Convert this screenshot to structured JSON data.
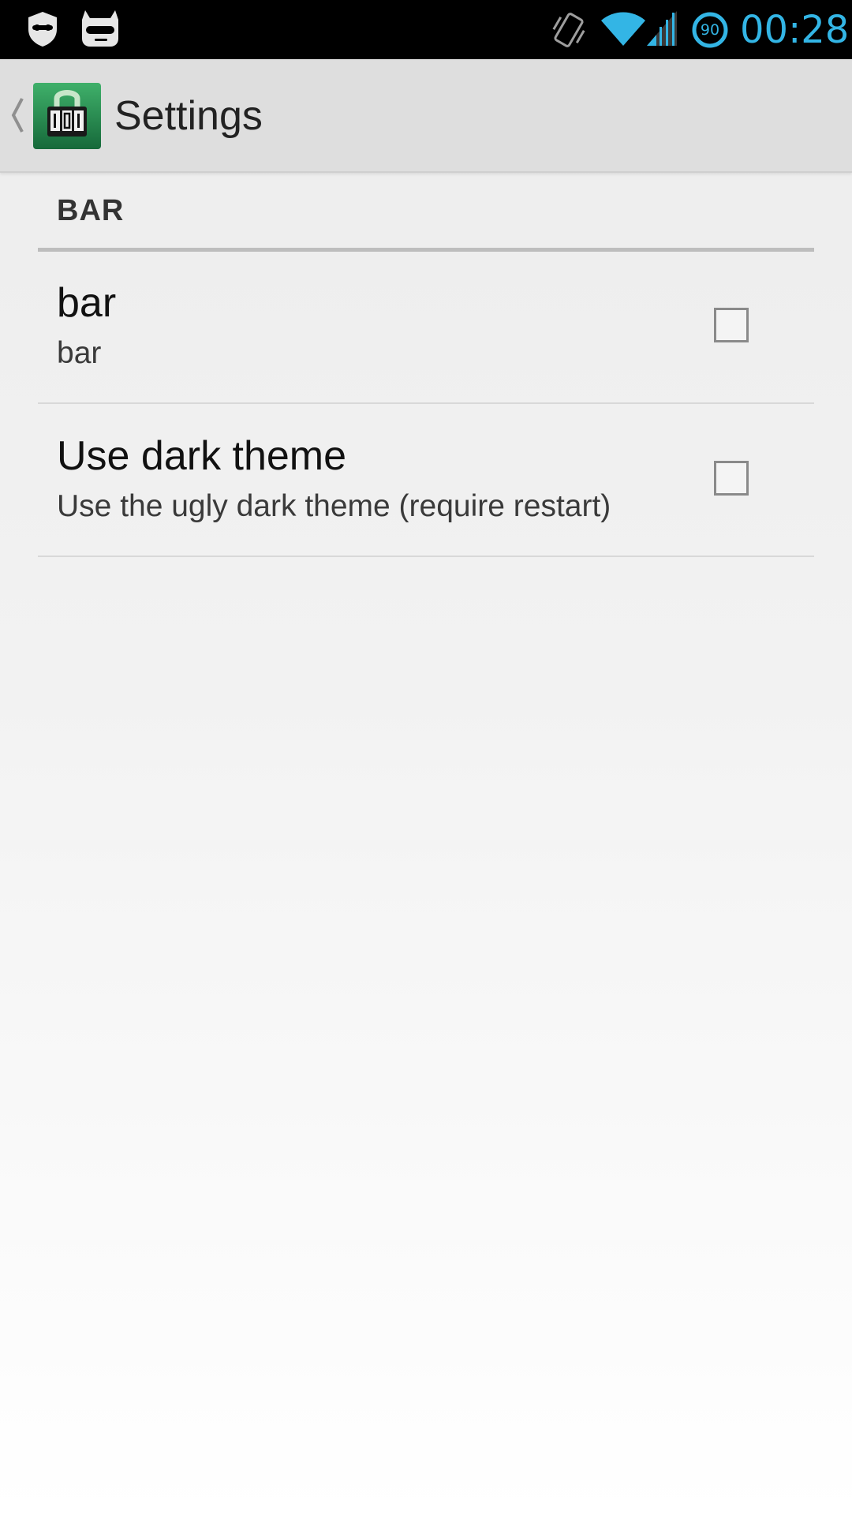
{
  "status_bar": {
    "clock": "00:28",
    "battery_level": "90",
    "icons": [
      "privacy-guard-icon",
      "cyanogenmod-icon",
      "vibrate-icon",
      "wifi-icon",
      "signal-icon",
      "battery-icon"
    ],
    "accent_color": "#33b5e5"
  },
  "action_bar": {
    "title": "Settings",
    "up_icon": "chevron-left-icon",
    "app_icon": "lock-counter-app-icon"
  },
  "preferences": {
    "category_title": "BAR",
    "items": [
      {
        "title": "bar",
        "summary": "bar",
        "checked": false
      },
      {
        "title": "Use dark theme",
        "summary": "Use the ugly dark theme (require restart)",
        "checked": false
      }
    ]
  }
}
